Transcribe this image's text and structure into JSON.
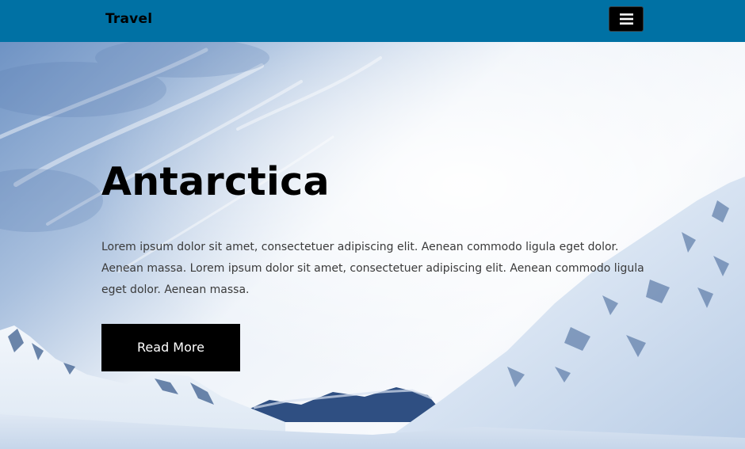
{
  "navbar": {
    "brand": "Travel",
    "menu_icon": "hamburger-menu-icon",
    "background_color": "#0071a4"
  },
  "hero": {
    "title": "Antarctica",
    "description": "Lorem ipsum dolor sit amet, consectetuer adipiscing elit. Aenean commodo ligula eget dolor. Aenean massa. Lorem ipsum dolor sit amet, consectetuer adipiscing elit. Aenean commodo ligula eget dolor. Aenean massa.",
    "button_label": "Read More",
    "background_image": "snowy-mountains-under-blue-sky"
  }
}
